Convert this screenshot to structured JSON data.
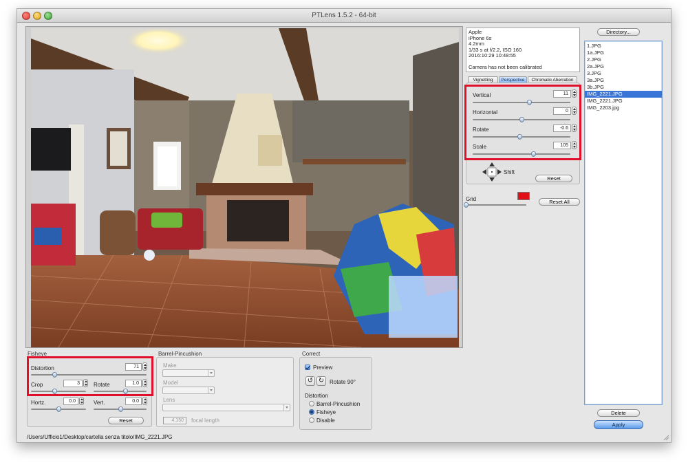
{
  "window": {
    "title": "PTLens 1.5.2 - 64-bit"
  },
  "colors": {
    "accent": "#3875d7",
    "highlight_box": "#e0102a",
    "grid_swatch": "#e10f16"
  },
  "exif": {
    "lines": [
      "Apple",
      "iPhone 6s",
      "4.2mm",
      "1/33 s at f/2.2, ISO 160",
      "2016:10:29 10:48:55",
      "",
      "Camera has not been calibrated"
    ]
  },
  "tabs": {
    "vignetting": "Vignetting",
    "perspective": "Perspective",
    "chromatic": "Chromatic Aberration",
    "active": "Perspective"
  },
  "perspective": {
    "vertical": {
      "label": "Vertical",
      "value": "11",
      "fraction": 0.58
    },
    "horizontal": {
      "label": "Horizontal",
      "value": "0",
      "fraction": 0.5
    },
    "rotate": {
      "label": "Rotate",
      "value": "-0.6",
      "fraction": 0.48
    },
    "scale": {
      "label": "Scale",
      "value": "105",
      "fraction": 0.62
    },
    "shift_label": "Shift",
    "reset_label": "Reset"
  },
  "grid": {
    "label": "Grid",
    "reset_all_label": "Reset All",
    "fraction": 0.0
  },
  "fisheye": {
    "title": "Fisheye",
    "distortion": {
      "label": "Distortion",
      "value": "71",
      "fraction": 0.2
    },
    "crop": {
      "label": "Crop",
      "value": "3",
      "fraction": 0.42
    },
    "rotate": {
      "label": "Rotate",
      "value": "1.0",
      "fraction": 0.6
    },
    "hortz": {
      "label": "Hortz.",
      "value": "0.0",
      "fraction": 0.5
    },
    "vert": {
      "label": "Vert.",
      "value": "0.0",
      "fraction": 0.5
    },
    "reset_label": "Reset"
  },
  "barrel": {
    "title": "Barrel-Pincushion",
    "make_label": "Make",
    "model_label": "Model",
    "lens_label": "Lens",
    "focal_value": "4.150",
    "focal_label": "focal length"
  },
  "correct": {
    "title": "Correct",
    "preview_label": "Preview",
    "rotate_label": "Rotate 90°",
    "distortion_label": "Distortion",
    "options": [
      "Barrel-Pincushion",
      "Fisheye",
      "Disable"
    ],
    "selected": "Fisheye"
  },
  "files": {
    "directory_label": "Directory...",
    "items": [
      "1.JPG",
      "1a.JPG",
      "2.JPG",
      "2a.JPG",
      "3.JPG",
      "3a.JPG",
      "3b.JPG",
      "IMG_2221.JPG",
      "IMG_2221.JPG",
      "IMG_2203.jpg"
    ],
    "selected_index": 7,
    "delete_label": "Delete",
    "apply_label": "Apply"
  },
  "status": {
    "path": "/Users/Ufficio1/Desktop/cartella senza titolo/IMG_2221.JPG"
  }
}
